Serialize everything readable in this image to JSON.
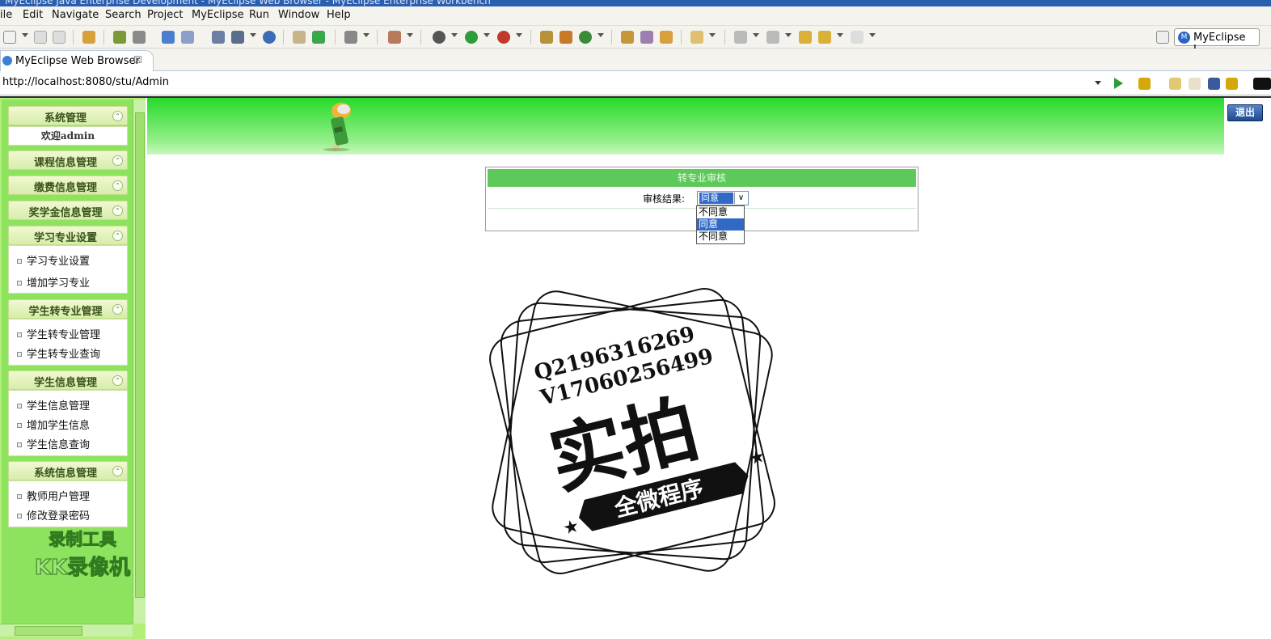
{
  "window": {
    "title": "MyEclipse Java Enterprise Development - MyEclipse Web Browser - MyEclipse Enterprise Workbench"
  },
  "menubar": {
    "items": [
      "ile",
      "Edit",
      "Navigate",
      "Search",
      "Project",
      "MyEclipse",
      "Run",
      "Window",
      "Help"
    ]
  },
  "toolbar": {
    "perspective_label": "MyEclipse J...",
    "perspective_icon": "M"
  },
  "tab": {
    "label": "MyEclipse Web Browser",
    "close": "☒"
  },
  "browser": {
    "url": "http://localhost:8080/stu/Admin"
  },
  "app": {
    "logout_label": "退出",
    "welcome": "欢迎admin",
    "menus": [
      {
        "title": "系统管理",
        "items": []
      },
      {
        "title": "课程信息管理",
        "items": []
      },
      {
        "title": "缴费信息管理",
        "items": []
      },
      {
        "title": "奖学金信息管理",
        "items": []
      },
      {
        "title": "学习专业设置",
        "items": [
          "学习专业设置",
          "增加学习专业"
        ]
      },
      {
        "title": "学生转专业管理",
        "items": [
          "学生转专业管理",
          "学生转专业查询"
        ]
      },
      {
        "title": "学生信息管理",
        "items": [
          "学生信息管理",
          "增加学生信息",
          "学生信息查询"
        ]
      },
      {
        "title": "系统信息管理",
        "items": [
          "教师用户管理",
          "修改登录密码"
        ]
      }
    ],
    "toggle_glyph": "⌃",
    "form": {
      "header": "转专业审核",
      "result_label": "审核结果:",
      "selected": "同意",
      "options": [
        "不同意",
        "同意",
        "不同意"
      ]
    }
  },
  "watermark": {
    "line1": "Q2196316269",
    "line2": "V17060256499",
    "big": "实拍",
    "ribbon": "全微程序",
    "recorder_l1": "录制工具",
    "recorder_l2": "KK录像机"
  }
}
